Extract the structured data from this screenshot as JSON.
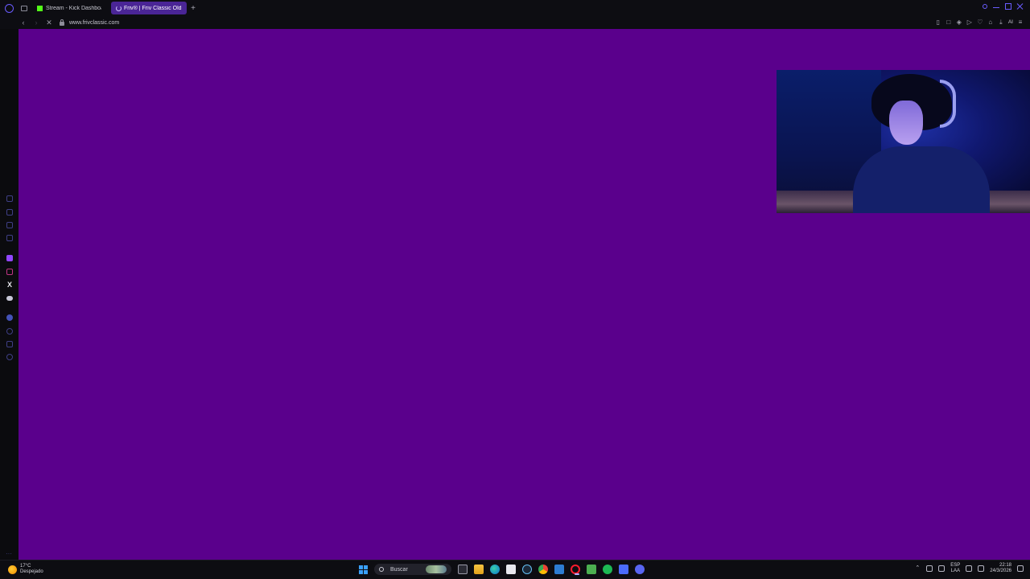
{
  "browser": {
    "tabs": [
      {
        "label": "Stream - Kick Dashboard",
        "active": false,
        "favicon": "kick-icon"
      },
      {
        "label": "Friv® | Friv Classic Old Ma",
        "active": true,
        "favicon": "loading-spinner-icon"
      }
    ],
    "new_tab_label": "+",
    "url": "www.frivclassic.com",
    "ai_label": "AI"
  },
  "sidebar": {
    "icons": [
      "history-icon",
      "shopping-icon",
      "wallet-icon",
      "news-icon",
      "twitch-icon",
      "instagram-icon",
      "x-icon",
      "discord-icon",
      "spotify-icon",
      "clock-icon",
      "send-icon",
      "settings-icon"
    ],
    "more": "···"
  },
  "page": {
    "background_color": "#5a008c"
  },
  "taskbar": {
    "weather_temp": "17°C",
    "weather_desc": "Despejado",
    "search_placeholder": "Buscar",
    "apps": [
      "start-icon",
      "task-view-icon",
      "file-explorer-icon",
      "edge-icon",
      "store-icon",
      "steam-icon",
      "chrome-icon",
      "visual-studio-icon",
      "opera-gx-icon",
      "minecraft-icon",
      "spotify-icon",
      "app-icon",
      "discord-icon"
    ],
    "lang_top": "ESP",
    "lang_bottom": "LAA",
    "time": "22:18",
    "date": "24/3/2026"
  }
}
